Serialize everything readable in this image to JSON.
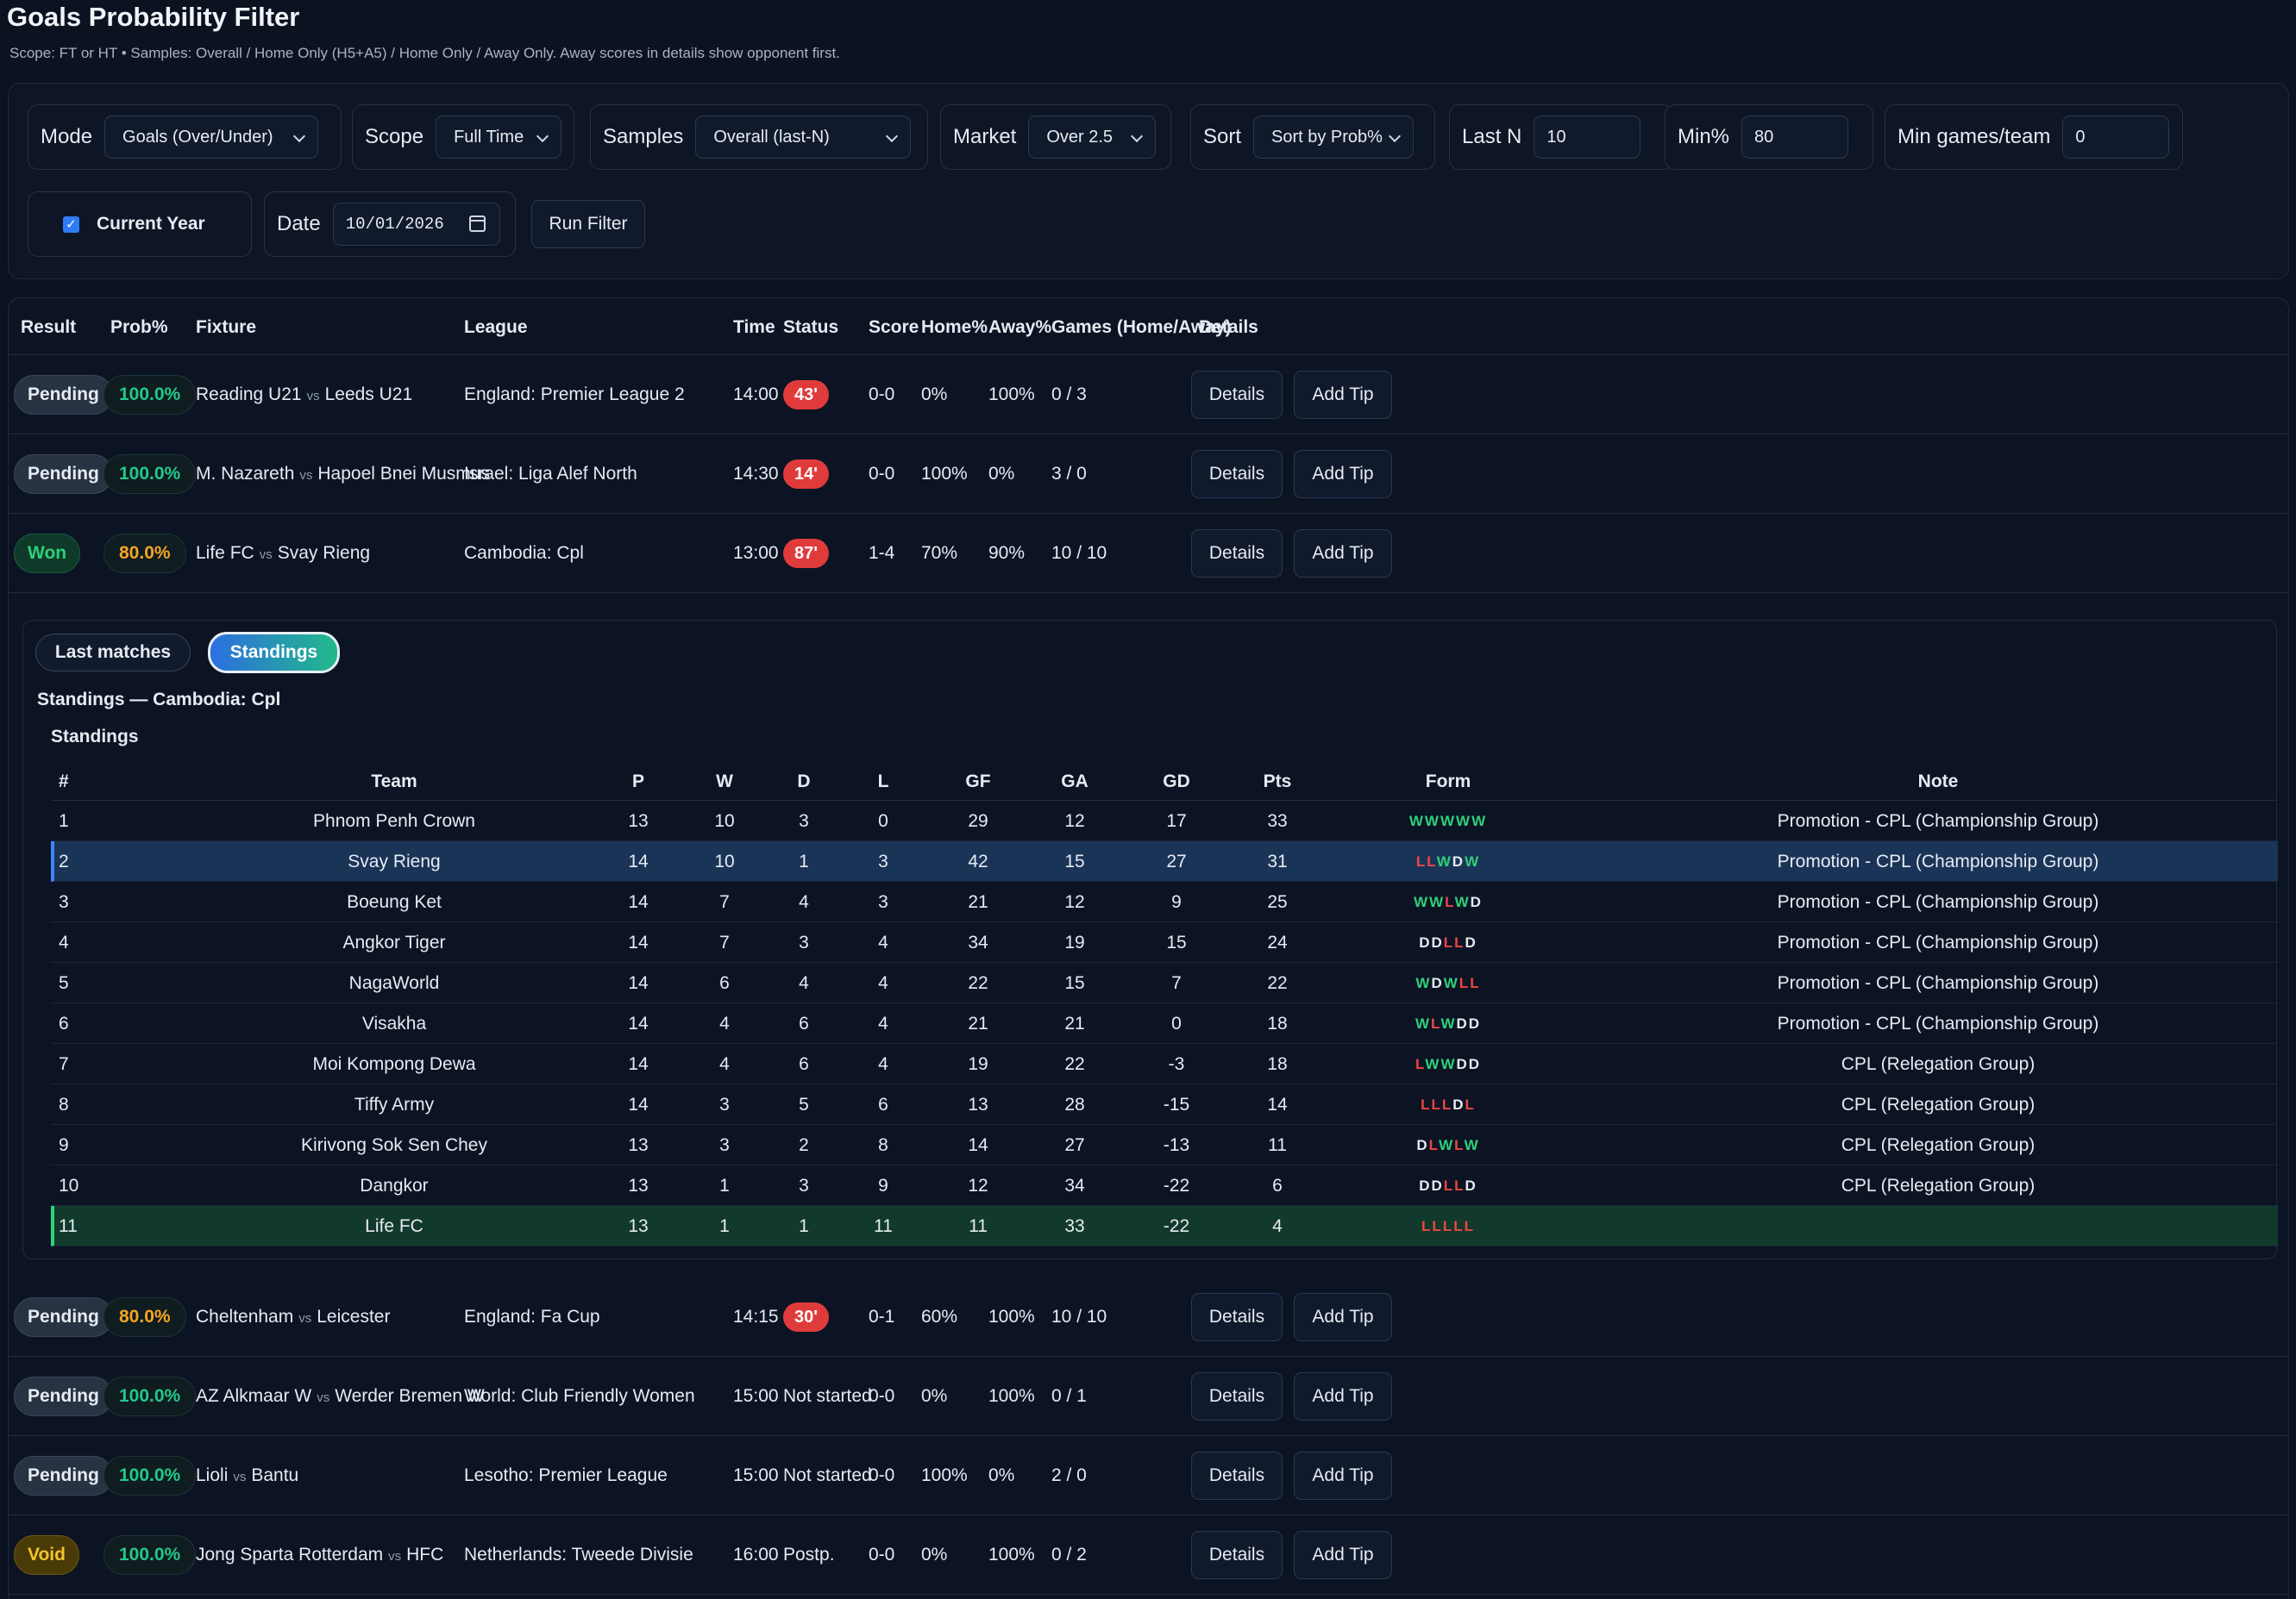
{
  "page": {
    "title": "Goals Probability Filter",
    "subtitle": "Scope: FT or HT • Samples: Overall / Home Only (H5+A5) / Home Only / Away Only. Away scores in details show opponent first."
  },
  "filters": {
    "mode_label": "Mode",
    "mode_value": "Goals (Over/Under)",
    "scope_label": "Scope",
    "scope_value": "Full Time",
    "samples_label": "Samples",
    "samples_value": "Overall (last-N)",
    "market_label": "Market",
    "market_value": "Over 2.5",
    "sort_label": "Sort",
    "sort_value": "Sort by Prob%",
    "lastn_label": "Last N",
    "lastn_value": "10",
    "minpct_label": "Min%",
    "minpct_value": "80",
    "mingames_label": "Min games/team",
    "mingames_value": "0",
    "current_year_label": "Current Year",
    "current_year_checked": true,
    "date_label": "Date",
    "date_value": "10/01/2026",
    "run_button": "Run Filter"
  },
  "table": {
    "headers": [
      "Result",
      "Prob%",
      "Fixture",
      "League",
      "Time",
      "Status",
      "Score",
      "Home%",
      "Away%",
      "Games (Home/Away)",
      "Details"
    ],
    "vs": "vs",
    "details_button": "Details",
    "addtip_button": "Add Tip",
    "rows": [
      {
        "result": "Pending",
        "result_type": "pending",
        "prob": "100.0%",
        "prob_color": "green",
        "home": "Reading U21",
        "away": "Leeds U21",
        "league": "England: Premier League 2",
        "time": "14:00",
        "status": "43'",
        "status_live": true,
        "score": "0-0",
        "home_pct": "0%",
        "away_pct": "100%",
        "games": "0 / 3"
      },
      {
        "result": "Pending",
        "result_type": "pending",
        "prob": "100.0%",
        "prob_color": "green",
        "home": "M. Nazareth",
        "away": "Hapoel Bnei Musmus",
        "league": "Israel: Liga Alef North",
        "time": "14:30",
        "status": "14'",
        "status_live": true,
        "score": "0-0",
        "home_pct": "100%",
        "away_pct": "0%",
        "games": "3 / 0"
      },
      {
        "result": "Won",
        "result_type": "won",
        "prob": "80.0%",
        "prob_color": "orange",
        "home": "Life FC",
        "away": "Svay Rieng",
        "league": "Cambodia: Cpl",
        "time": "13:00",
        "status": "87'",
        "status_live": true,
        "score": "1-4",
        "home_pct": "70%",
        "away_pct": "90%",
        "games": "10 / 10"
      },
      {
        "result": "Pending",
        "result_type": "pending",
        "prob": "80.0%",
        "prob_color": "orange",
        "home": "Cheltenham",
        "away": "Leicester",
        "league": "England: Fa Cup",
        "time": "14:15",
        "status": "30'",
        "status_live": true,
        "score": "0-1",
        "home_pct": "60%",
        "away_pct": "100%",
        "games": "10 / 10"
      },
      {
        "result": "Pending",
        "result_type": "pending",
        "prob": "100.0%",
        "prob_color": "green",
        "home": "AZ Alkmaar W",
        "away": "Werder Bremen W",
        "league": "World: Club Friendly Women",
        "time": "15:00",
        "status": "Not started",
        "status_live": false,
        "score": "0-0",
        "home_pct": "0%",
        "away_pct": "100%",
        "games": "0 / 1"
      },
      {
        "result": "Pending",
        "result_type": "pending",
        "prob": "100.0%",
        "prob_color": "green",
        "home": "Lioli",
        "away": "Bantu",
        "league": "Lesotho: Premier League",
        "time": "15:00",
        "status": "Not started",
        "status_live": false,
        "score": "0-0",
        "home_pct": "100%",
        "away_pct": "0%",
        "games": "2 / 0"
      },
      {
        "result": "Void",
        "result_type": "void",
        "prob": "100.0%",
        "prob_color": "green",
        "home": "Jong Sparta Rotterdam",
        "away": "HFC",
        "league": "Netherlands: Tweede Divisie",
        "time": "16:00",
        "status": "Postp.",
        "status_live": false,
        "score": "0-0",
        "home_pct": "0%",
        "away_pct": "100%",
        "games": "0 / 2"
      }
    ]
  },
  "details": {
    "tab_last": "Last matches",
    "tab_standings": "Standings",
    "active_tab": "Standings",
    "standings_title": "Standings — Cambodia: Cpl",
    "standings_subtitle": "Standings",
    "headers": [
      "#",
      "Team",
      "P",
      "W",
      "D",
      "L",
      "GF",
      "GA",
      "GD",
      "Pts",
      "Form",
      "Note"
    ],
    "rows": [
      {
        "pos": "1",
        "team": "Phnom Penh Crown",
        "p": "13",
        "w": "10",
        "d": "3",
        "l": "0",
        "gf": "29",
        "ga": "12",
        "gd": "17",
        "pts": "33",
        "form": "WWWWW",
        "note": "Promotion - CPL (Championship Group)",
        "highlight": ""
      },
      {
        "pos": "2",
        "team": "Svay Rieng",
        "p": "14",
        "w": "10",
        "d": "1",
        "l": "3",
        "gf": "42",
        "ga": "15",
        "gd": "27",
        "pts": "31",
        "form": "LLWDW",
        "note": "Promotion - CPL (Championship Group)",
        "highlight": "blue"
      },
      {
        "pos": "3",
        "team": "Boeung Ket",
        "p": "14",
        "w": "7",
        "d": "4",
        "l": "3",
        "gf": "21",
        "ga": "12",
        "gd": "9",
        "pts": "25",
        "form": "WWLWD",
        "note": "Promotion - CPL (Championship Group)",
        "highlight": ""
      },
      {
        "pos": "4",
        "team": "Angkor Tiger",
        "p": "14",
        "w": "7",
        "d": "3",
        "l": "4",
        "gf": "34",
        "ga": "19",
        "gd": "15",
        "pts": "24",
        "form": "DDLLD",
        "note": "Promotion - CPL (Championship Group)",
        "highlight": ""
      },
      {
        "pos": "5",
        "team": "NagaWorld",
        "p": "14",
        "w": "6",
        "d": "4",
        "l": "4",
        "gf": "22",
        "ga": "15",
        "gd": "7",
        "pts": "22",
        "form": "WDWLL",
        "note": "Promotion - CPL (Championship Group)",
        "highlight": ""
      },
      {
        "pos": "6",
        "team": "Visakha",
        "p": "14",
        "w": "4",
        "d": "6",
        "l": "4",
        "gf": "21",
        "ga": "21",
        "gd": "0",
        "pts": "18",
        "form": "WLWDD",
        "note": "Promotion - CPL (Championship Group)",
        "highlight": ""
      },
      {
        "pos": "7",
        "team": "Moi Kompong Dewa",
        "p": "14",
        "w": "4",
        "d": "6",
        "l": "4",
        "gf": "19",
        "ga": "22",
        "gd": "-3",
        "pts": "18",
        "form": "LWWDD",
        "note": "CPL (Relegation Group)",
        "highlight": ""
      },
      {
        "pos": "8",
        "team": "Tiffy Army",
        "p": "14",
        "w": "3",
        "d": "5",
        "l": "6",
        "gf": "13",
        "ga": "28",
        "gd": "-15",
        "pts": "14",
        "form": "LLLDL",
        "note": "CPL (Relegation Group)",
        "highlight": ""
      },
      {
        "pos": "9",
        "team": "Kirivong Sok Sen Chey",
        "p": "13",
        "w": "3",
        "d": "2",
        "l": "8",
        "gf": "14",
        "ga": "27",
        "gd": "-13",
        "pts": "11",
        "form": "DLWLW",
        "note": "CPL (Relegation Group)",
        "highlight": ""
      },
      {
        "pos": "10",
        "team": "Dangkor",
        "p": "13",
        "w": "1",
        "d": "3",
        "l": "9",
        "gf": "12",
        "ga": "34",
        "gd": "-22",
        "pts": "6",
        "form": "DDLLD",
        "note": "CPL (Relegation Group)",
        "highlight": ""
      },
      {
        "pos": "11",
        "team": "Life FC",
        "p": "13",
        "w": "1",
        "d": "1",
        "l": "11",
        "gf": "11",
        "ga": "33",
        "gd": "-22",
        "pts": "4",
        "form": "LLLLL",
        "note": "",
        "highlight": "green"
      }
    ]
  }
}
